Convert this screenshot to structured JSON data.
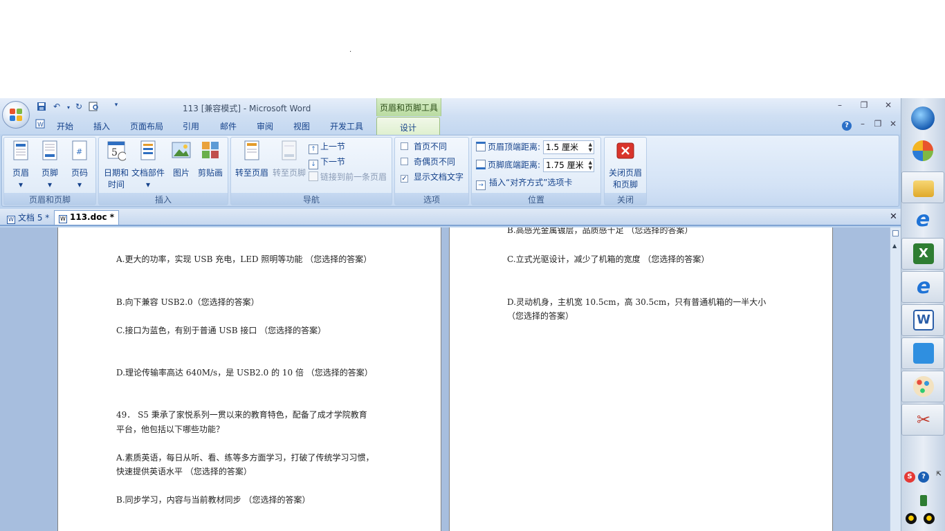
{
  "window": {
    "title": "113 [兼容模式] - Microsoft Word",
    "context_group": "页眉和页脚工具"
  },
  "tabs": {
    "home": "开始",
    "insert": "插入",
    "layout": "页面布局",
    "references": "引用",
    "mailings": "邮件",
    "review": "审阅",
    "view": "视图",
    "developer": "开发工具",
    "design": "设计"
  },
  "ribbon": {
    "hf_group": {
      "label": "页眉和页脚",
      "header": "页眉",
      "footer": "页脚",
      "page_number": "页码"
    },
    "insert_group": {
      "label": "插入",
      "datetime_1": "日期和",
      "datetime_2": "时间",
      "quickparts": "文档部件",
      "picture": "图片",
      "clipart": "剪贴画"
    },
    "nav_group": {
      "label": "导航",
      "goto_header": "转至页眉",
      "goto_footer": "转至页脚",
      "prev": "上一节",
      "next": "下一节",
      "link_prev": "链接到前一条页眉"
    },
    "options_group": {
      "label": "选项",
      "diff_first": "首页不同",
      "diff_odd_even": "奇偶页不同",
      "show_text": "显示文档文字"
    },
    "position_group": {
      "label": "位置",
      "header_dist_label": "页眉顶端距离:",
      "header_dist_value": "1.5 厘米",
      "footer_dist_label": "页脚底端距离:",
      "footer_dist_value": "1.75 厘米",
      "insert_align": "插入“对齐方式”选项卡"
    },
    "close_group": {
      "label": "关闭",
      "close_1": "关闭页眉",
      "close_2": "和页脚"
    }
  },
  "doc_tabs": [
    "文档 5 *",
    "113.doc *"
  ],
  "left_page": [
    "A.更大的功率，实现 USB 充电，LED 照明等功能 （您选择的答案）",
    "B.向下兼容 USB2.0（您选择的答案）",
    "C.接口为蓝色，有别于普通 USB 接口 （您选择的答案）",
    "D.理论传输率高达 640M/s，是 USB2.0 的 10 倍 （您选择的答案）",
    "49． S5 秉承了家悦系列一贯以来的教育特色，配备了成才学院教育",
    "平台，他包括以下哪些功能？",
    "A.素质英语，每日从听、看、练等多方面学习，打破了传统学习习惯，",
    "快速提供英语水平 （您选择的答案）",
    "B.同步学习，内容与当前教材同步 （您选择的答案）"
  ],
  "right_page": [
    "B.高感光金属镀层，品质感十足 （您选择的答案）",
    "C.立式光驱设计，减少了机箱的宽度 （您选择的答案）",
    "D.灵动机身，主机宽 10.5cm，高 30.5cm，只有普通机箱的一半大小",
    "（您选择的答案）"
  ],
  "colors": {
    "accent": "#15428b",
    "context_green": "#b9dba0",
    "close_red": "#d9342b"
  },
  "icons": [
    "office-orb-icon",
    "save-icon",
    "undo-icon",
    "redo-icon",
    "print-preview-icon",
    "help-icon"
  ]
}
